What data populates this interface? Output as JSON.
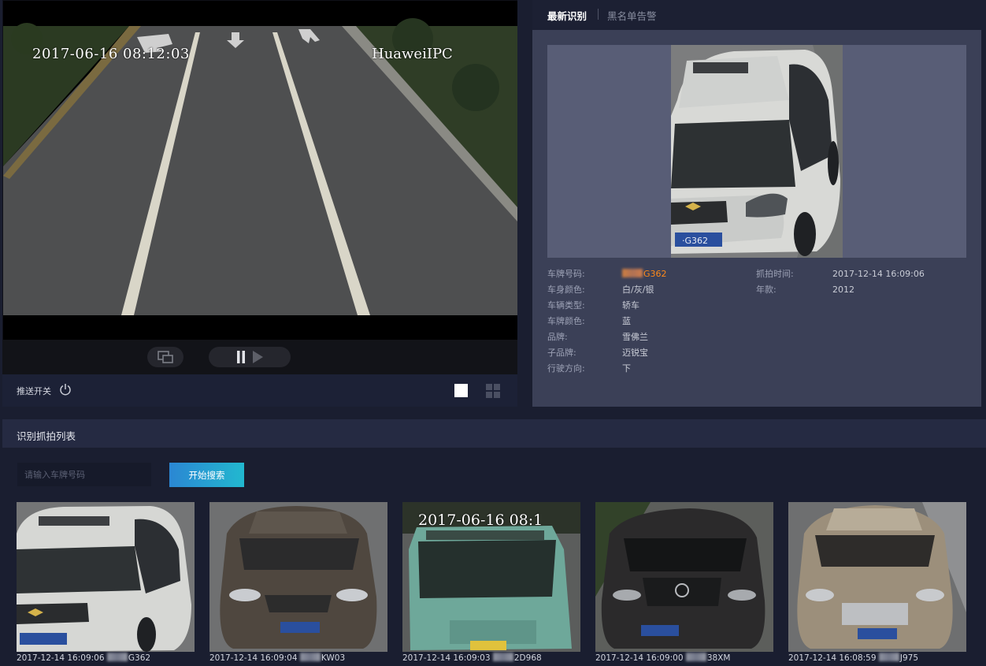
{
  "video": {
    "osd_time": "2017-06-16 08:12:03",
    "osd_name": "HuaweiIPC"
  },
  "controls": {
    "push_label": "推送开关",
    "icons": [
      "screen-icon",
      "pause-icon",
      "play-icon",
      "power-icon",
      "single-layout-icon",
      "quad-layout-icon"
    ]
  },
  "tabs": {
    "latest": "最新识别",
    "blacklist": "黑名单告警"
  },
  "detail": {
    "fields": {
      "plate_label": "车牌号码:",
      "plate_value": "G362",
      "color_label": "车身颜色:",
      "color_value": "白/灰/银",
      "type_label": "车辆类型:",
      "type_value": "轿车",
      "plate_color_label": "车牌颜色:",
      "plate_color_value": "蓝",
      "brand_label": "品牌:",
      "brand_value": "雪佛兰",
      "sub_brand_label": "子品牌:",
      "sub_brand_value": "迈锐宝",
      "direction_label": "行驶方向:",
      "direction_value": "下",
      "time_label": "抓拍时间:",
      "time_value": "2017-12-14 16:09:06",
      "year_label": "年款:",
      "year_value": "2012"
    },
    "plate_color_hex": "#ff8a1a"
  },
  "list": {
    "title": "识别抓拍列表",
    "search_placeholder": "请输入车牌号码",
    "search_value": "",
    "search_button": "开始搜索",
    "thumb_osd": "2017-06-16 08:1",
    "items": [
      {
        "time": "2017-12-14 16:09:06",
        "plate": "G362"
      },
      {
        "time": "2017-12-14 16:09:04",
        "plate": "KW03"
      },
      {
        "time": "2017-12-14 16:09:03",
        "plate": "2D968"
      },
      {
        "time": "2017-12-14 16:09:00",
        "plate": "38XM"
      },
      {
        "time": "2017-12-14 16:08:59",
        "plate": "J975"
      }
    ]
  }
}
